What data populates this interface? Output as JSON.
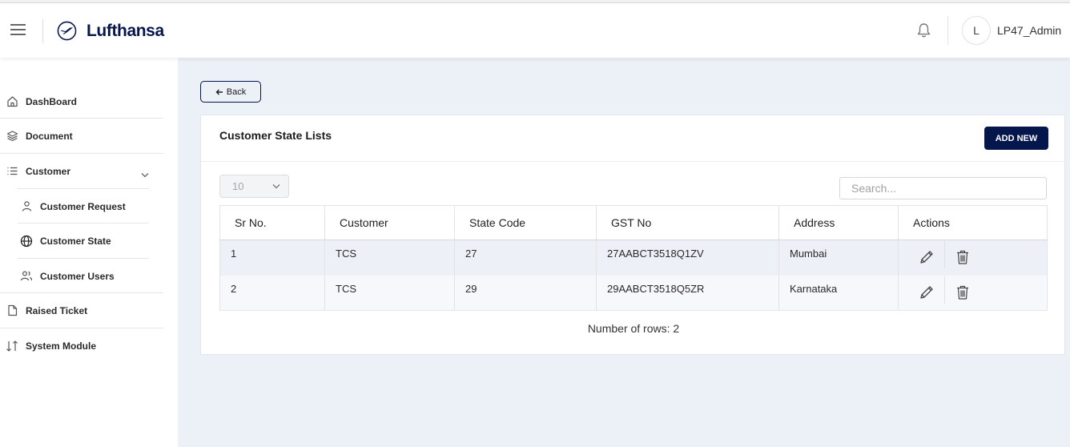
{
  "header": {
    "brand": "Lufthansa",
    "avatar_initial": "L",
    "username": "LP47_Admin"
  },
  "sidebar": {
    "items": [
      {
        "label": "DashBoard",
        "icon": "home-icon"
      },
      {
        "label": "Document",
        "icon": "layers-icon"
      },
      {
        "label": "Customer",
        "icon": "list-icon"
      },
      {
        "label": "Customer Request",
        "icon": "user-icon"
      },
      {
        "label": "Customer State",
        "icon": "globe-icon"
      },
      {
        "label": "Customer Users",
        "icon": "users-icon"
      },
      {
        "label": "Raised Ticket",
        "icon": "file-icon"
      },
      {
        "label": "System Module",
        "icon": "sort-arrows-icon"
      }
    ]
  },
  "main": {
    "back_label": "Back",
    "card_title": "Customer State Lists",
    "add_new_label": "ADD NEW",
    "page_size": "10",
    "search_placeholder": "Search...",
    "table": {
      "columns": [
        "Sr No.",
        "Customer",
        "State Code",
        "GST No",
        "Address",
        "Actions"
      ],
      "rows": [
        {
          "sr": "1",
          "customer": "TCS",
          "state_code": "27",
          "gst": "27AABCT3518Q1ZV",
          "address": "Mumbai"
        },
        {
          "sr": "2",
          "customer": "TCS",
          "state_code": "29",
          "gst": "29AABCT3518Q5ZR",
          "address": "Karnataka"
        }
      ]
    },
    "rows_count": "Number of rows: 2"
  },
  "colors": {
    "brand_navy": "#05164d",
    "page_bg": "#ecf0f7",
    "row_highlight": "#edf0f6"
  }
}
